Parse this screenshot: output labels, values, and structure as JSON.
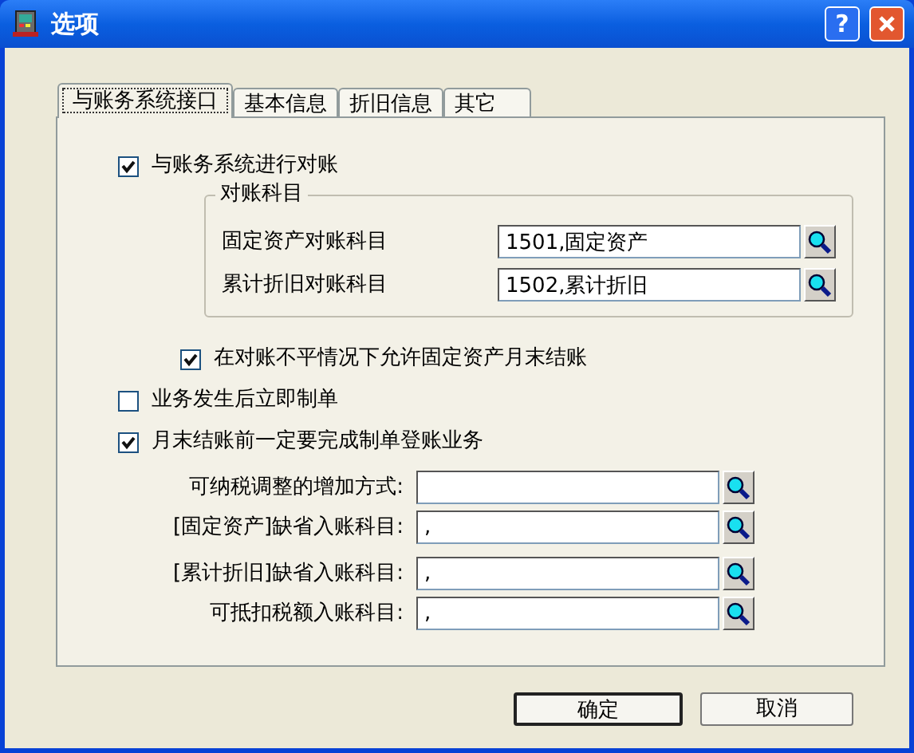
{
  "window": {
    "title": "选项",
    "help_button": "?"
  },
  "tabs": [
    {
      "label": "与账务系统接口",
      "selected": true
    },
    {
      "label": "基本信息",
      "selected": false
    },
    {
      "label": "折旧信息",
      "selected": false
    },
    {
      "label": "其它",
      "selected": false
    }
  ],
  "sync_checkbox": {
    "label": "与账务系统进行对账",
    "checked": true
  },
  "reconcile_group": {
    "title": "对账科目",
    "fields": [
      {
        "label": "固定资产对账科目",
        "value": "1501,固定资产"
      },
      {
        "label": "累计折旧对账科目",
        "value": "1502,累计折旧"
      }
    ]
  },
  "allow_checkbox": {
    "label": "在对账不平情况下允许固定资产月末结账",
    "checked": true
  },
  "checkboxes": [
    {
      "label": "业务发生后立即制单",
      "checked": false
    },
    {
      "label": "月末结账前一定要完成制单登账业务",
      "checked": true
    }
  ],
  "account_fields": [
    {
      "label": "可纳税调整的增加方式:"
    },
    {
      "label": "[固定资产]缺省入账科目:",
      "value": ","
    },
    {
      "label": "[累计折旧]缺省入账科目:",
      "value": ","
    },
    {
      "label": "可抵扣税额入账科目:",
      "value": ","
    }
  ],
  "buttons": [
    {
      "label": "确定",
      "default": true
    },
    {
      "label": "取消",
      "default": false
    }
  ]
}
